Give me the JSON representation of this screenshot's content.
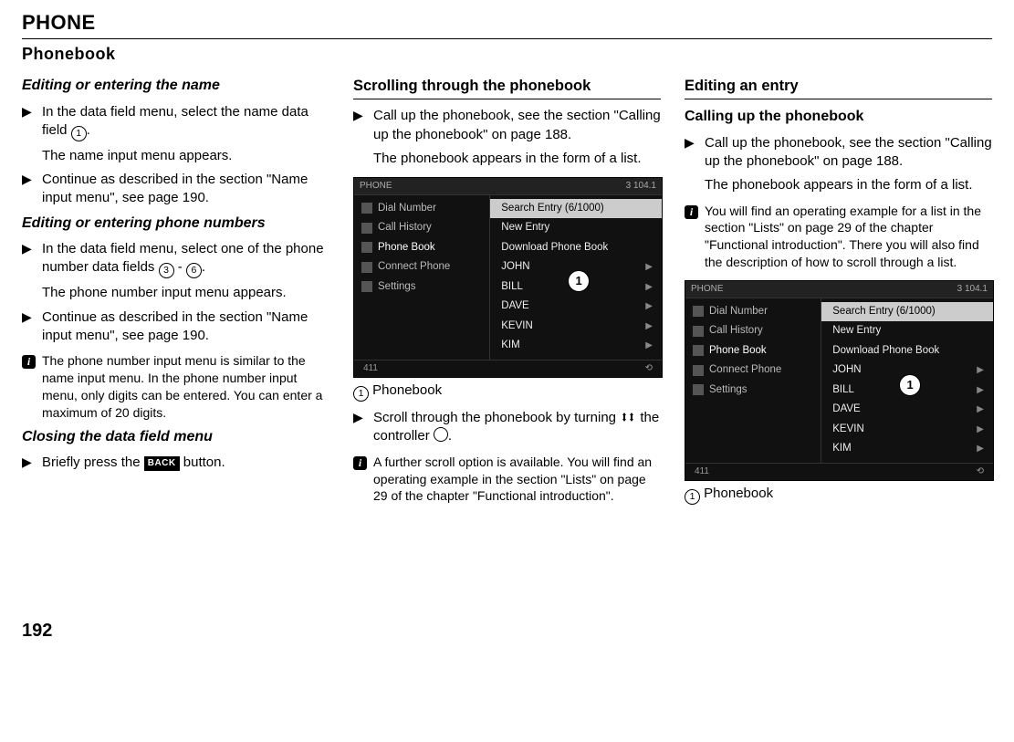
{
  "page": {
    "title": "PHONE",
    "subtitle": "Phonebook",
    "number": "192"
  },
  "col1": {
    "h_name": "Editing or entering the name",
    "s1a": "In the data field menu, select the name data field ",
    "s1b": ".",
    "r1": "The name input menu appears.",
    "s2": "Continue as described in the section \"Name input menu\", see page 190.",
    "h_nums": "Editing or entering phone numbers",
    "s3a": "In the data field menu, select one of the phone number data fields ",
    "s3mid": " - ",
    "s3b": ".",
    "r3": "The phone number input menu appears.",
    "s4": "Continue as described in the section \"Name input menu\", see page 190.",
    "info1": "The phone number input menu is similar to the name input menu. In the phone number input menu, only digits can be entered. You can enter a maximum of 20 digits.",
    "h_close": "Closing the data field menu",
    "s5a": "Briefly press the ",
    "s5b": " button.",
    "back": "BACK"
  },
  "col2": {
    "h_scroll": "Scrolling through the phonebook",
    "s1": "Call up the phonebook, see the section \"Calling up the phonebook\" on page 188.",
    "r1": "The phonebook appears in the form of a list.",
    "cap": "Phonebook",
    "s2a": "Scroll through the phonebook by turning ",
    "s2b": " the controller ",
    "s2c": ".",
    "info1": "A further scroll option is available. You will find an operating example in the section \"Lists\" on page 29 of the chapter \"Functional introduction\"."
  },
  "col3": {
    "h_edit": "Editing an entry",
    "h_call": "Calling up the phonebook",
    "s1": "Call up the phonebook, see the section \"Calling up the phonebook\" on page 188.",
    "r1": "The phonebook appears in the form of a list.",
    "info1": "You will find an operating example for a list in the section \"Lists\" on page 29 of the chapter \"Functional introduction\". There you will also find the description of how to scroll through a list.",
    "cap": "Phonebook"
  },
  "circles": {
    "c1": "1",
    "c3": "3",
    "c6": "6"
  },
  "screen": {
    "top_left": "PHONE",
    "top_right": "3   104.1",
    "side": {
      "i1": "Dial Number",
      "i2": "Call History",
      "i3": "Phone Book",
      "i4": "Connect Phone",
      "i5": "Settings"
    },
    "right": {
      "r0": "Search Entry (6/1000)",
      "r1": "New Entry",
      "r2": "Download Phone Book",
      "r3": "JOHN",
      "r4": "BILL",
      "r5": "DAVE",
      "r6": "KEVIN",
      "r7": "KIM"
    },
    "callout": "1",
    "bot_left": "411",
    "bot_right": "⟲"
  }
}
